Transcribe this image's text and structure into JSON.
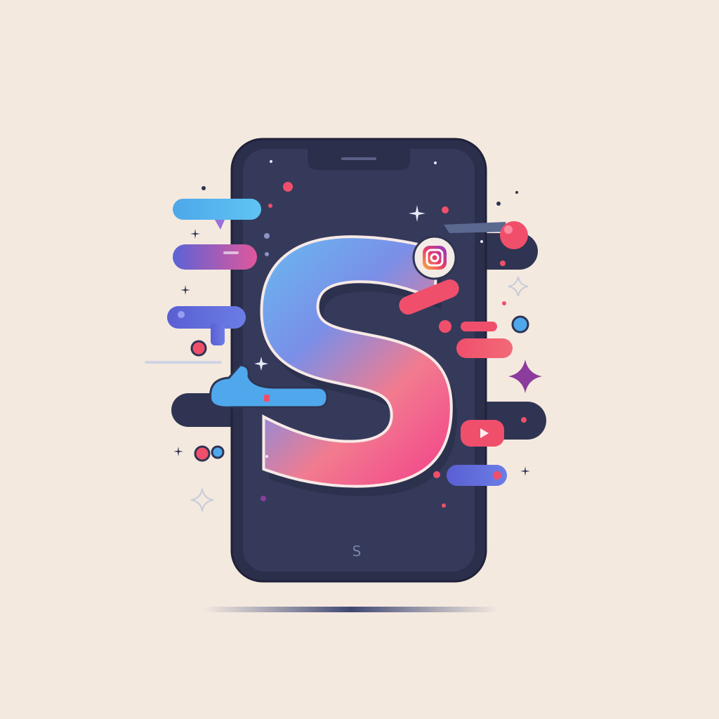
{
  "illustration": {
    "letter": "S",
    "small_mark": "S",
    "badge_icon": "instagram-icon",
    "icons": [
      "sparkle-icon",
      "chat-bubble-icon",
      "play-icon"
    ]
  },
  "colors": {
    "background": "#f4e9df",
    "phone_body": "#2e3250",
    "phone_screen": "#353a5b",
    "gradient_top": "#55c7f2",
    "gradient_bottom": "#f4438a",
    "pill_blue": "#4fa8ec",
    "pill_pink": "#f0526a",
    "pill_purple": "#6b61d6"
  }
}
